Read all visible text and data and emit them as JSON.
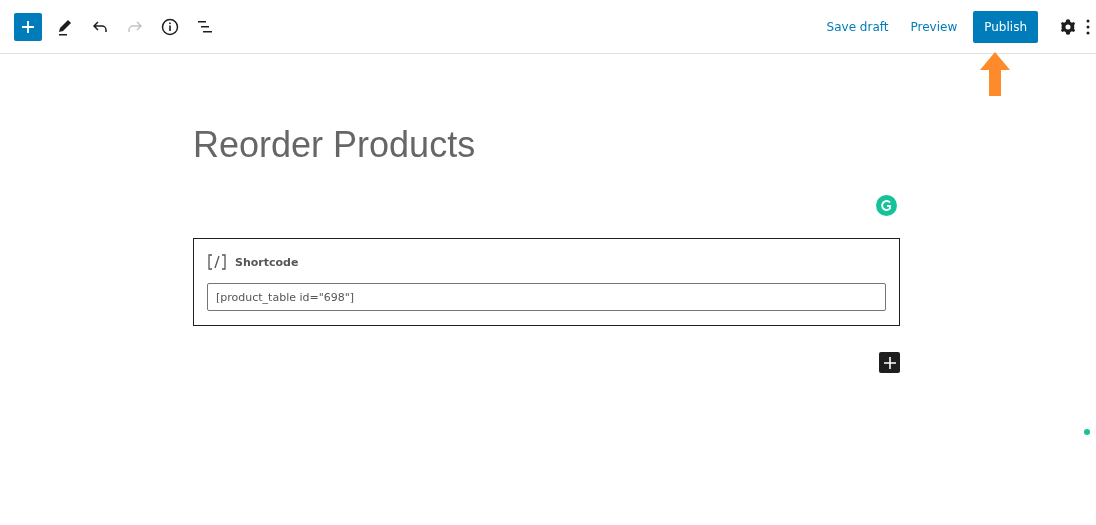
{
  "toolbar": {
    "tools": [
      {
        "kind": "add",
        "disabled": false
      },
      {
        "kind": "edit",
        "disabled": false
      },
      {
        "kind": "undo",
        "disabled": false
      },
      {
        "kind": "redo",
        "disabled": true
      },
      {
        "kind": "info",
        "disabled": false
      },
      {
        "kind": "outline",
        "disabled": false
      }
    ],
    "save_draft": "Save draft",
    "preview": "Preview",
    "publish": "Publish"
  },
  "post": {
    "title": "Reorder Products",
    "block": {
      "label": "Shortcode",
      "value": "[product_table id=\"698\"]"
    }
  }
}
